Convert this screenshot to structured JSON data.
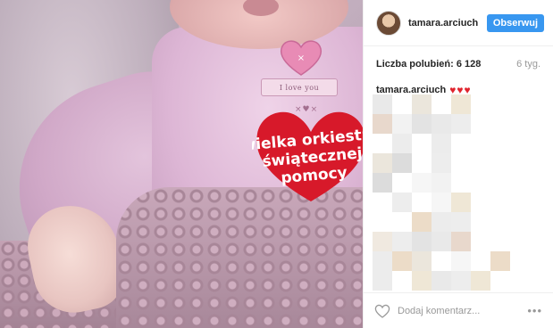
{
  "photo": {
    "heart_tag_text": "I love you",
    "xox_text": "×♥×",
    "badge_lines": [
      "wielka orkiestra",
      "świątecznej",
      "pomocy"
    ]
  },
  "header": {
    "username": "tamara.arciuch",
    "follow_label": "Obserwuj"
  },
  "stats": {
    "likes_label": "Liczba polubień: 6 128",
    "time": "6 tyg."
  },
  "caption": {
    "username": "tamara.arciuch",
    "hearts": "♥♥♥"
  },
  "footer": {
    "comment_placeholder": "Dodaj komentarz...",
    "more": "•••"
  },
  "colors": {
    "follow_button": "#3897f0",
    "hearts": "#e0242d",
    "badge_red": "#d7192a"
  },
  "icons": [
    "heart-outline-icon",
    "more-options-icon"
  ]
}
